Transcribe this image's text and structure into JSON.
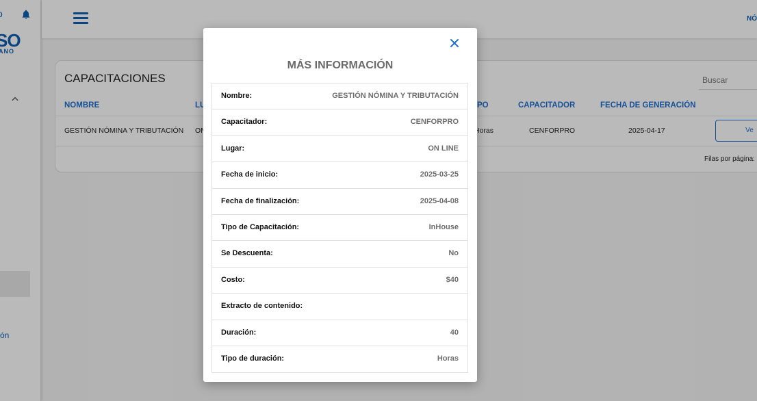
{
  "sidebar": {
    "top_partial": "o",
    "logo_text": "SO",
    "logo_sub": "ANO",
    "partial_item": "ón"
  },
  "topbar": {
    "right_partial": "NÓ"
  },
  "card": {
    "title": "CAPACITACIONES",
    "search_placeholder": "Buscar",
    "columns": [
      {
        "label": "NOMBRE"
      },
      {
        "label": "LU"
      },
      {
        "label": "PO"
      },
      {
        "label": "CAPACITADOR"
      },
      {
        "label": "FECHA DE GENERACIÓN"
      }
    ],
    "row": {
      "nombre": "GESTIÓN NÓMINA Y TRIBUTACIÓN",
      "lugar": "ON",
      "tipo": "Horas",
      "capacitador": "CENFORPRO",
      "fecha": "2025-04-17",
      "action": "Ve"
    },
    "rows_per_page": "Filas por página:"
  },
  "modal": {
    "title": "MÁS INFORMACIÓN",
    "fields": [
      {
        "label": "Nombre:",
        "value": "GESTIÓN NÓMINA Y TRIBUTACIÓN"
      },
      {
        "label": "Capacitador:",
        "value": "CENFORPRO"
      },
      {
        "label": "Lugar:",
        "value": "ON LINE"
      },
      {
        "label": "Fecha de inicio:",
        "value": "2025-03-25"
      },
      {
        "label": "Fecha de finalización:",
        "value": "2025-04-08"
      },
      {
        "label": "Tipo de Capacitación:",
        "value": "InHouse"
      },
      {
        "label": "Se Descuenta:",
        "value": "No"
      },
      {
        "label": "Costo:",
        "value": "$40"
      },
      {
        "label": "Extracto de contenido:",
        "value": ""
      },
      {
        "label": "Duración:",
        "value": "40"
      },
      {
        "label": "Tipo de duración:",
        "value": "Horas"
      }
    ]
  },
  "colors": {
    "accent": "#1f6fd0",
    "brand": "#0d5fb3"
  }
}
